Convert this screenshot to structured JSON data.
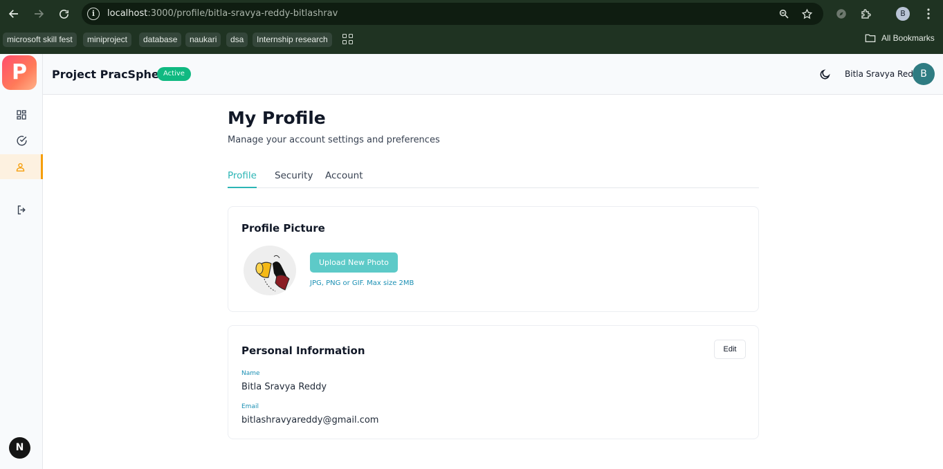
{
  "browser": {
    "url_host": "localhost",
    "url_path": ":3000/profile/bitla-sravya-reddy-bitlashrav",
    "profile_initial": "B",
    "bookmarks": [
      "microsoft skill fest",
      "miniproject",
      "database",
      "naukari",
      "dsa",
      "Internship research"
    ],
    "all_bookmarks_label": "All Bookmarks"
  },
  "app": {
    "logo_letter": "P",
    "title": "Project PracSphere",
    "status": "Active",
    "accent_color": "#2cb5b5",
    "status_color": "#10b981",
    "active_nav_color": "#f59e0b",
    "framework_badge": "N"
  },
  "sidebar": {
    "items": [
      {
        "name": "dashboard",
        "icon": "grid-icon"
      },
      {
        "name": "tasks",
        "icon": "check-circle-icon"
      },
      {
        "name": "profile",
        "icon": "user-icon",
        "active": true
      },
      {
        "name": "logout",
        "icon": "logout-icon"
      }
    ]
  },
  "user": {
    "name": "Bitla Sravya Reddy",
    "initial": "B"
  },
  "page": {
    "title": "My Profile",
    "subtitle": "Manage your account settings and preferences",
    "tabs": [
      {
        "label": "Profile",
        "active": true
      },
      {
        "label": "Security",
        "active": false
      },
      {
        "label": "Account",
        "active": false
      }
    ]
  },
  "profile_picture": {
    "title": "Profile Picture",
    "upload_label": "Upload New Photo",
    "hint": "JPG, PNG or GIF. Max size 2MB"
  },
  "personal_info": {
    "title": "Personal Information",
    "edit_label": "Edit",
    "name_label": "Name",
    "name_value": "Bitla Sravya Reddy",
    "email_label": "Email",
    "email_value": "bitlashravyareddy@gmail.com"
  }
}
